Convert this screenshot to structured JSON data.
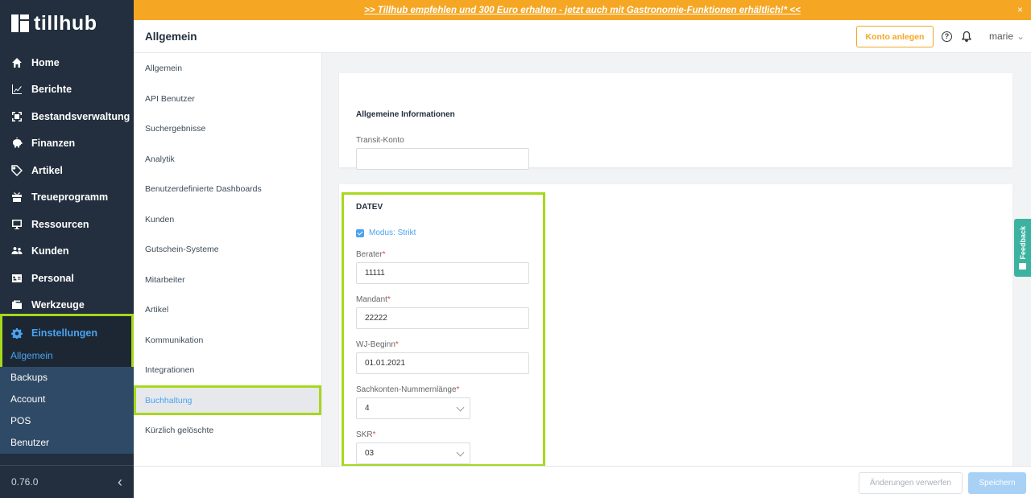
{
  "brand": {
    "name": "tillhub"
  },
  "banner": {
    "text": ">> Tillhub empfehlen und 300 Euro erhalten - jetzt auch mit Gastronomie-Funktionen erhältlich!* <<",
    "close": "×"
  },
  "sidebar": {
    "items": [
      {
        "label": "Home",
        "icon": "home-icon"
      },
      {
        "label": "Berichte",
        "icon": "chart-icon"
      },
      {
        "label": "Bestandsverwaltung",
        "icon": "inventory-icon"
      },
      {
        "label": "Finanzen",
        "icon": "piggy-bank-icon"
      },
      {
        "label": "Artikel",
        "icon": "tag-icon"
      },
      {
        "label": "Treueprogramm",
        "icon": "gift-icon"
      },
      {
        "label": "Ressourcen",
        "icon": "monitor-icon"
      },
      {
        "label": "Kunden",
        "icon": "people-icon"
      },
      {
        "label": "Personal",
        "icon": "id-card-icon"
      },
      {
        "label": "Werkzeuge",
        "icon": "folder-icon"
      }
    ],
    "settings": {
      "label": "Einstellungen",
      "icon": "gear-icon",
      "sub_active": "Allgemein"
    },
    "subitems": [
      "Backups",
      "Account",
      "POS",
      "Benutzer"
    ],
    "version": "0.76.0",
    "collapse_icon": "‹"
  },
  "header": {
    "title": "Allgemein",
    "konto_btn": "Konto anlegen",
    "help": "?",
    "user": "marie",
    "user_chev": "⌄"
  },
  "subnav": {
    "items": [
      "Allgemein",
      "API Benutzer",
      "Suchergebnisse",
      "Analytik",
      "Benutzerdefinierte Dashboards",
      "Kunden",
      "Gutschein-Systeme",
      "Mitarbeiter",
      "Artikel",
      "Kommunikation",
      "Integrationen",
      "Buchhaltung",
      "Kürzlich gelöschte"
    ],
    "active_index": 11
  },
  "general_card": {
    "title": "Allgemeine Informationen",
    "transit_label": "Transit-Konto",
    "transit_value": ""
  },
  "datev": {
    "title": "DATEV",
    "mode_label": "Modus: Strikt",
    "mode_checked": true,
    "berater_label": "Berater",
    "berater_value": "11111",
    "mandant_label": "Mandant",
    "mandant_value": "22222",
    "wj_label": "WJ-Beginn",
    "wj_value": "01.01.2021",
    "sachkonten_label": "Sachkonten-Nummernlänge",
    "sachkonten_value": "4",
    "skr_label": "SKR",
    "skr_value": "03",
    "required_mark": "*"
  },
  "feedback": {
    "label": "Feedback"
  },
  "footer": {
    "discard": "Änderungen verwerfen",
    "save": "Speichern"
  },
  "colors": {
    "accent": "#4aa3f0",
    "brand_orange": "#f5a623",
    "sidebar_bg": "#232f3e",
    "highlight": "#a6d81e"
  }
}
